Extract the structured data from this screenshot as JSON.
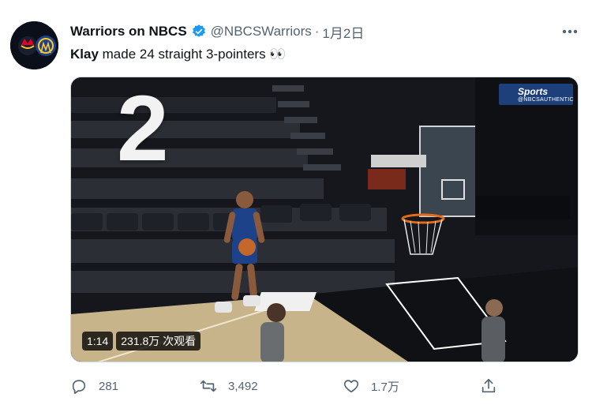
{
  "tweet": {
    "author_name": "Warriors on NBCS",
    "handle": "@NBCSWarriors",
    "separator": "·",
    "date": "1月2日",
    "verified": true,
    "text_strong": "Klay",
    "text_rest": " made 24 straight 3-pointers 👀"
  },
  "media": {
    "counter_overlay": "2",
    "broadcaster_logo": "Sports",
    "broadcaster_sub": "@NBCSAUTHENTIC",
    "duration": "1:14",
    "views": "231.8万 次观看",
    "colors": {
      "court": "#c8b48a",
      "seats": "#2b2e35",
      "arena_dark": "#15171c"
    }
  },
  "actions": {
    "reply_count": "281",
    "retweet_count": "3,492",
    "like_count": "1.7万",
    "icons": [
      "reply-icon",
      "retweet-icon",
      "like-icon",
      "share-icon"
    ]
  },
  "colors": {
    "accent": "#1d9bf0",
    "muted": "#536471",
    "text": "#0f1419"
  }
}
